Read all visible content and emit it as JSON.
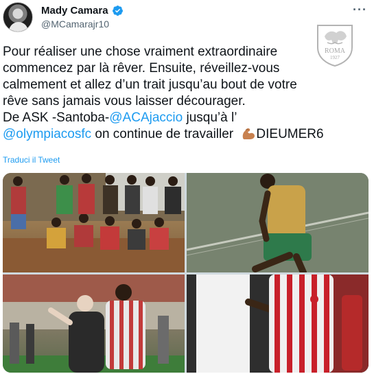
{
  "tweet": {
    "author_name": "Mady Camara",
    "author_handle": "@MCamarajr10",
    "more_glyph": "···",
    "text": {
      "l1": "Pour réaliser une chose vraiment extraordinaire",
      "l2": "commencez par là rêver. Ensuite, réveillez-vous",
      "l3": "calmement et allez d’un trait jusqu’au bout de votre",
      "l4": "rêve sans jamais vous laisser décourager.",
      "l5_pre": "De ASK -Santoba-",
      "l5_link": "@ACAjaccio",
      "l5_post": " jusqu’à l’",
      "l6_link": "@olympiacosfc",
      "l6_post": "  on continue de travailler ",
      "l6_tag": "DIEUMER6"
    },
    "translate_label": "Traduci il Tweet"
  },
  "watermark": {
    "text": "ROMA",
    "sub": "1927"
  },
  "colors": {
    "link": "#1d9bf0",
    "text": "#0f1419",
    "secondary": "#536471"
  },
  "icons": [
    "verified-badge-icon",
    "more-icon",
    "flexed-biceps-icon"
  ]
}
